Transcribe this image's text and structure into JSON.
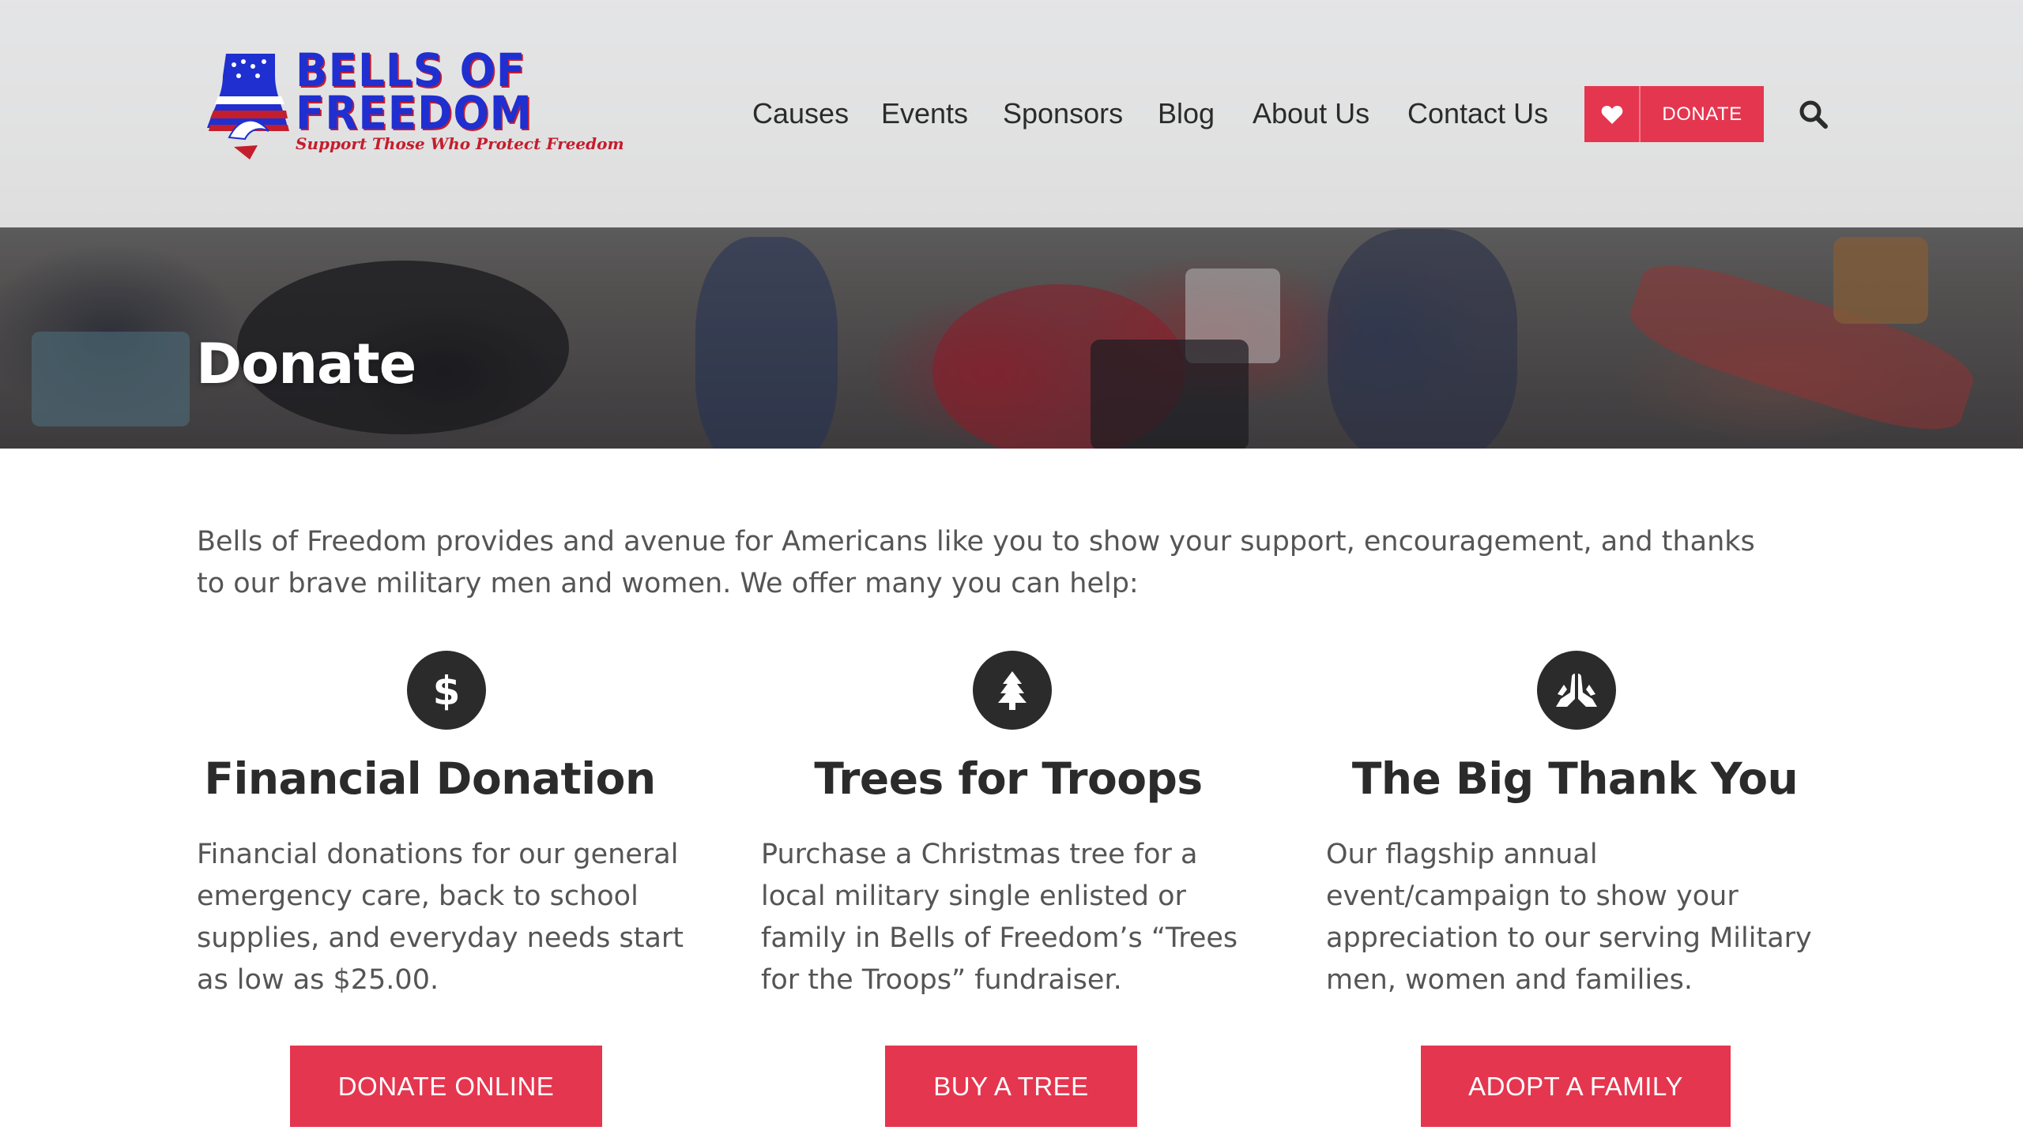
{
  "logo": {
    "title_line1": "BELLS OF",
    "title_line2": "FREEDOM",
    "tagline": "Support Those Who Protect Freedom",
    "colors": {
      "blue": "#1f2fd0",
      "red": "#c41d2c"
    }
  },
  "nav": {
    "items": [
      "Causes",
      "Events",
      "Sponsors",
      "Blog",
      "About Us",
      "Contact Us"
    ],
    "donate_label": "DONATE",
    "donate_icon": "heart-icon",
    "search_icon": "search-icon"
  },
  "hero": {
    "title": "Donate"
  },
  "intro": "Bells of Freedom provides and avenue for Americans like you to show your support, encouragement, and thanks to our brave military men and women. We offer many you can help:",
  "columns": [
    {
      "icon": "dollar-icon",
      "heading": "Financial Donation",
      "text": "Financial donations for our general emergency care, back to school supplies, and everyday needs start as low as $25.00.",
      "button": "DONATE ONLINE"
    },
    {
      "icon": "tree-icon",
      "heading": "Trees for Troops",
      "text": "Purchase a Christmas tree for a local military single enlisted or family in Bells of Freedom’s “Trees for the Troops” fundraiser.",
      "button": "BUY A TREE"
    },
    {
      "icon": "praying-hands-icon",
      "heading": "The Big Thank You",
      "text": "Our flagship annual event/campaign to show your appreciation to our serving Military men, women and families.",
      "button": "ADOPT A FAMILY"
    }
  ],
  "colors": {
    "accent": "#e5364f",
    "heading": "#2b2b2b",
    "body_text": "#555555"
  }
}
